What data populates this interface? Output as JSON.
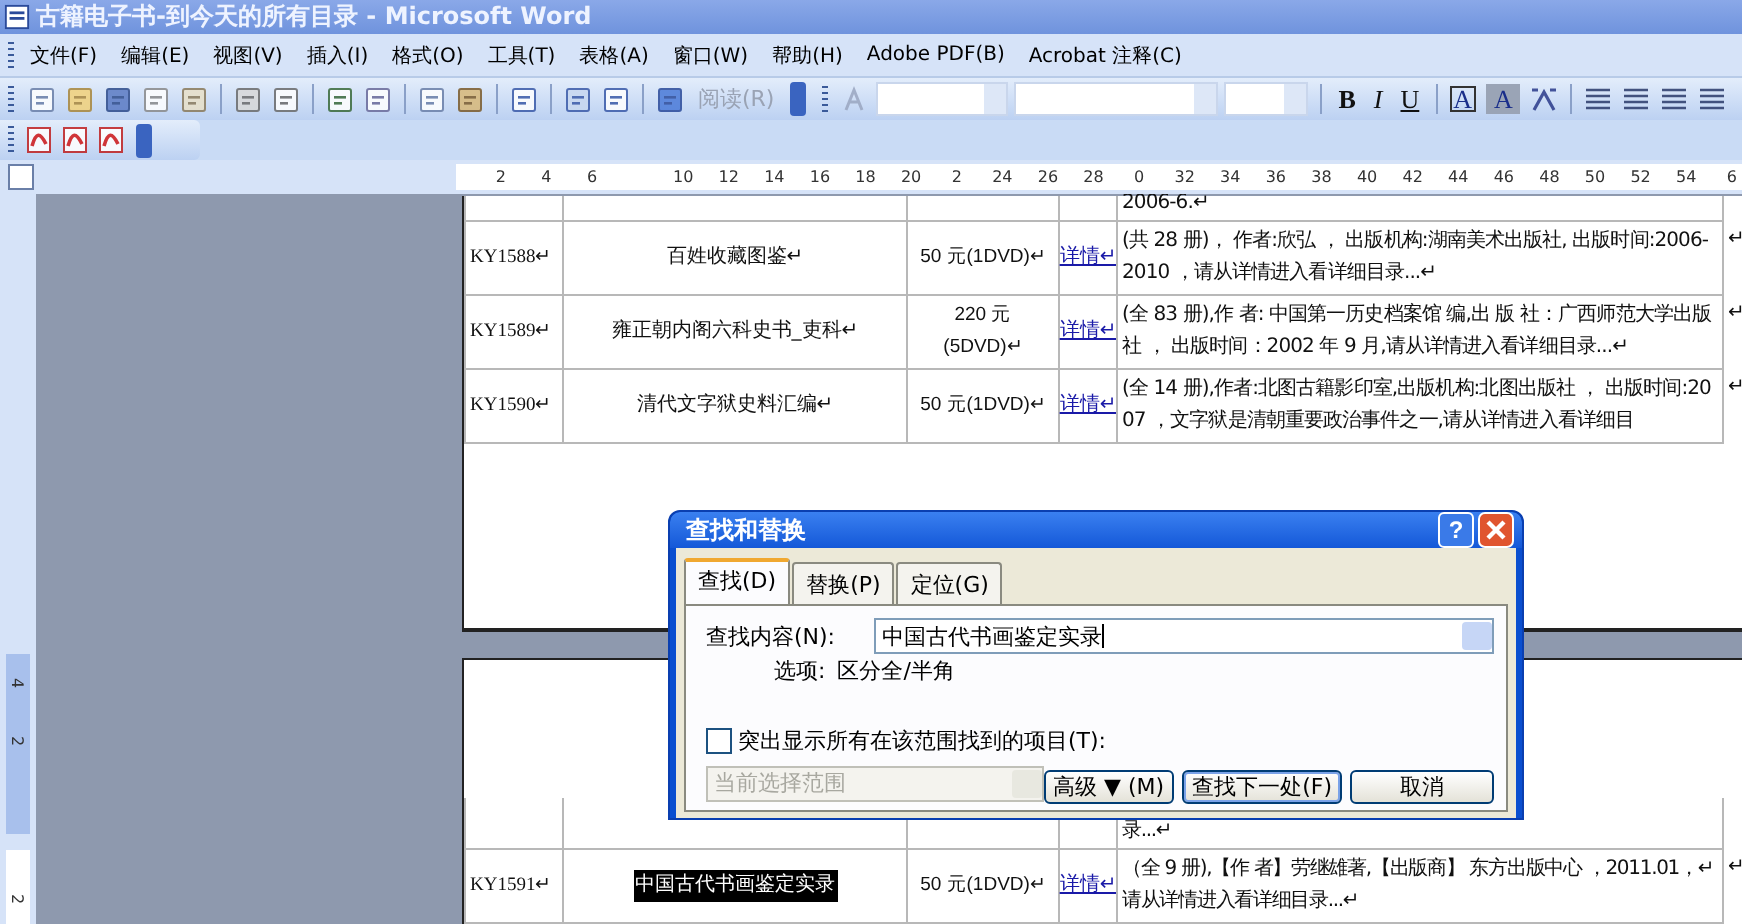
{
  "window": {
    "title": "古籍电子书-到今天的所有目录 - Microsoft Word"
  },
  "menu": [
    "文件(F)",
    "编辑(E)",
    "视图(V)",
    "插入(I)",
    "格式(O)",
    "工具(T)",
    "表格(A)",
    "窗口(W)",
    "帮助(H)",
    "Adobe PDF(B)",
    "Acrobat 注释(C)"
  ],
  "standard_toolbar": {
    "reading_button": {
      "label": "阅读(R)",
      "disabled": true
    }
  },
  "formatting_toolbar": {
    "bold": "B",
    "italic": "I",
    "underline": "U",
    "char_border": "A",
    "char_shading": "A"
  },
  "horizontal_ruler": {
    "labels": [
      "2",
      "4",
      "6",
      "10",
      "12",
      "14",
      "16",
      "18",
      "20",
      "2",
      "24",
      "26",
      "28",
      "0",
      "32",
      "34",
      "36",
      "38",
      "40",
      "42",
      "44",
      "46",
      "48",
      "50",
      "52",
      "54",
      "6"
    ]
  },
  "vertical_ruler": {
    "labels": [
      "4",
      "2",
      "2"
    ]
  },
  "pages": [
    {
      "rows": [
        {
          "kind": "partial",
          "description": "2006-6.↵"
        },
        {
          "kind": "full",
          "code": "KY1588↵",
          "name": "百姓收藏图鉴↵",
          "highlighted": false,
          "price": "50 元(1DVD)↵",
          "link": "详情↵",
          "description": "(共 28 册)， 作者:欣弘 ， 出版机构:湖南美术出版社, 出版时间:2006-2010 ，请从详情进入看详细目录...↵",
          "end_mark": "↵"
        },
        {
          "kind": "full",
          "code": "KY1589↵",
          "name": "雍正朝内阁六科史书_吏科↵",
          "highlighted": false,
          "price": "220 元\n(5DVD)↵",
          "link": "详情↵",
          "description": "(全 83 册),作 者: 中国第一历史档案馆 编,出 版 社：广西师范大学出版社 ， 出版时间：2002 年 9 月,请从详情进入看详细目录...↵",
          "end_mark": "↵"
        },
        {
          "kind": "full",
          "code": "KY1590↵",
          "name": "清代文字狱史料汇编↵",
          "highlighted": false,
          "price": "50 元(1DVD)↵",
          "link": "详情↵",
          "description": "(全 14 册),作者:北图古籍影印室,出版机构:北图出版社 ， 出版时间:2007 ，文字狱是清朝重要政治事件之一,请从详情进入看详细目",
          "end_mark": "↵"
        }
      ]
    },
    {
      "rows": [
        {
          "kind": "partial",
          "description": "录...↵"
        },
        {
          "kind": "full",
          "code": "KY1591↵",
          "name": "中国古代书画鉴定实录",
          "highlighted": true,
          "price": "50 元(1DVD)↵",
          "link": "详情↵",
          "description": "（全 9 册),【作 者】劳继雄著,【出版商】 东方出版中心 ，2011.01，↵\n请从详情进入看详细目录...↵",
          "end_mark": "↵"
        }
      ]
    }
  ],
  "find_replace_dialog": {
    "title": "查找和替换",
    "help": "?",
    "tabs": [
      {
        "label": "查找(D)",
        "selected": true
      },
      {
        "label": "替换(P)",
        "selected": false
      },
      {
        "label": "定位(G)",
        "selected": false
      }
    ],
    "find_label": "查找内容(N):",
    "find_value": "中国古代书画鉴定实录",
    "options_label": "选项:",
    "options_value": "区分全/半角",
    "highlight_checkbox": {
      "label": "突出显示所有在该范围找到的项目(T):",
      "checked": false
    },
    "scope_dropdown": {
      "value": "当前选择范围",
      "disabled": true
    },
    "buttons": [
      {
        "label": "高级 ▼ (M)",
        "default": false
      },
      {
        "label": "查找下一处(F)",
        "default": true
      },
      {
        "label": "取消",
        "default": false
      }
    ]
  }
}
